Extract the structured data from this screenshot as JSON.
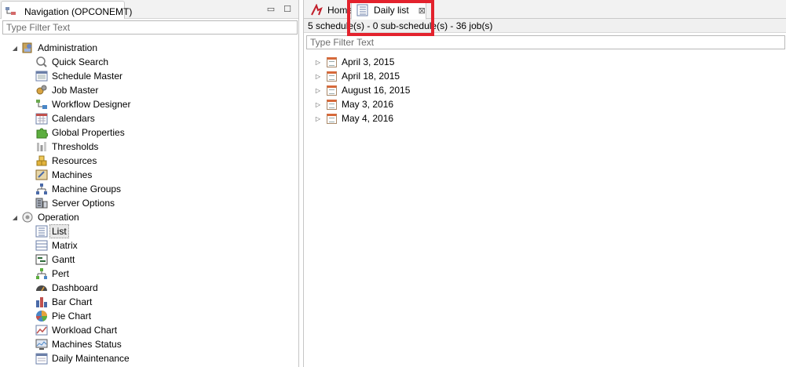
{
  "navigation": {
    "tab_title": "Navigation (OPCONEMT)",
    "minimize_glyph": "▭",
    "maximize_glyph": "☐",
    "filter_placeholder": "Type Filter Text"
  },
  "tree": {
    "administration": {
      "label": "Administration",
      "expander": "◢",
      "icon": "admin-icon",
      "items": [
        {
          "label": "Quick Search",
          "icon": "magnifier-icon"
        },
        {
          "label": "Schedule Master",
          "icon": "schedule-master-icon"
        },
        {
          "label": "Job Master",
          "icon": "gears-icon"
        },
        {
          "label": "Workflow Designer",
          "icon": "workflow-icon"
        },
        {
          "label": "Calendars",
          "icon": "calendar-icon"
        },
        {
          "label": "Global Properties",
          "icon": "puzzle-icon"
        },
        {
          "label": "Thresholds",
          "icon": "thresholds-icon"
        },
        {
          "label": "Resources",
          "icon": "resources-icon"
        },
        {
          "label": "Machines",
          "icon": "machine-icon"
        },
        {
          "label": "Machine Groups",
          "icon": "machine-groups-icon"
        },
        {
          "label": "Server Options",
          "icon": "server-options-icon"
        }
      ]
    },
    "operation": {
      "label": "Operation",
      "expander": "◢",
      "icon": "operation-icon",
      "items": [
        {
          "label": "List",
          "icon": "list-icon"
        },
        {
          "label": "Matrix",
          "icon": "matrix-icon"
        },
        {
          "label": "Gantt",
          "icon": "gantt-icon"
        },
        {
          "label": "Pert",
          "icon": "pert-icon"
        },
        {
          "label": "Dashboard",
          "icon": "dashboard-icon"
        },
        {
          "label": "Bar Chart",
          "icon": "bar-chart-icon"
        },
        {
          "label": "Pie Chart",
          "icon": "pie-chart-icon"
        },
        {
          "label": "Workload Chart",
          "icon": "workload-chart-icon"
        },
        {
          "label": "Machines Status",
          "icon": "machines-status-icon"
        },
        {
          "label": "Daily Maintenance",
          "icon": "daily-maintenance-icon"
        }
      ]
    }
  },
  "editor": {
    "tabs": [
      {
        "label": "Home",
        "icon": "home-icon"
      },
      {
        "label": "Daily list",
        "icon": "list-icon",
        "close": "⊠"
      }
    ],
    "summary": "5 schedule(s) - 0 sub-schedule(s) - 36 job(s)",
    "filter_placeholder": "Type Filter Text",
    "dates": [
      {
        "label": "April 3, 2015"
      },
      {
        "label": "April 18, 2015"
      },
      {
        "label": "August 16, 2015"
      },
      {
        "label": "May 3, 2016"
      },
      {
        "label": "May 4, 2016"
      }
    ],
    "collapsed_glyph": "▷"
  },
  "colors": {
    "highlight": "#e3222d",
    "pane_header": "#f2f2f2"
  }
}
